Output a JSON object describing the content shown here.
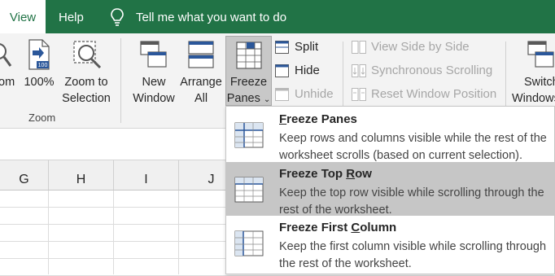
{
  "tabs": {
    "view": "View",
    "help": "Help"
  },
  "tell_me": {
    "placeholder": "Tell me what you want to do",
    "icon": "lightbulb-icon"
  },
  "zoom_group": {
    "label": "Zoom",
    "zoom_label_partial": "om",
    "zoom100_label": "100%",
    "zoom_to_selection_line1": "Zoom to",
    "zoom_to_selection_line2": "Selection"
  },
  "window_group": {
    "new_window_line1": "New",
    "new_window_line2": "Window",
    "arrange_all_line1": "Arrange",
    "arrange_all_line2": "All",
    "freeze_panes_line1": "Freeze",
    "freeze_panes_line2": "Panes",
    "split": "Split",
    "hide": "Hide",
    "unhide": "Unhide",
    "view_side_by_side": "View Side by Side",
    "synchronous_scrolling": "Synchronous Scrolling",
    "reset_window_position": "Reset Window Position",
    "switch_windows_line1": "Switch",
    "switch_windows_line2": "Windows"
  },
  "columns": [
    "G",
    "H",
    "I",
    "J"
  ],
  "freeze_menu": {
    "items": [
      {
        "title_pre": "",
        "title_ul": "F",
        "title_post": "reeze Panes",
        "desc": "Keep rows and columns visible while the rest of the worksheet scrolls (based on current selection)."
      },
      {
        "title_pre": "Freeze Top ",
        "title_ul": "R",
        "title_post": "ow",
        "desc": "Keep the top row visible while scrolling through the rest of the worksheet."
      },
      {
        "title_pre": "Freeze First ",
        "title_ul": "C",
        "title_post": "olumn",
        "desc": "Keep the first column visible while scrolling through the rest of the worksheet."
      }
    ]
  },
  "colors": {
    "accent": "#217346",
    "selected_item": "#c6c6c6",
    "icon_blue": "#2b579a"
  }
}
